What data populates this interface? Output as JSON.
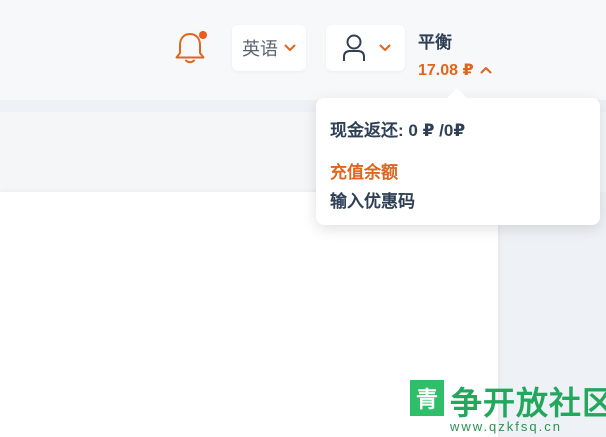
{
  "header": {
    "language": {
      "label": "英语"
    },
    "balance": {
      "title": "平衡",
      "amount": "17.08 ₽"
    }
  },
  "balance_dropdown": {
    "cashback_label": "现金返还:",
    "cashback_value": "0 ₽",
    "cashback_separator": "/",
    "cashback_total": "0₽",
    "topup_label": "充值余额",
    "promo_label": "输入优惠码"
  },
  "watermark": {
    "logo_char": "青",
    "name": "争开放社区",
    "url": "www.qzkfsq.cn"
  },
  "colors": {
    "accent": "#e0651d",
    "text_dark": "#2f3f55",
    "watermark_green": "#22a85c"
  },
  "icons": {
    "bell": "bell-icon",
    "user": "user-icon",
    "chevron_down": "chevron-down-icon",
    "chevron_up": "chevron-up-icon"
  }
}
